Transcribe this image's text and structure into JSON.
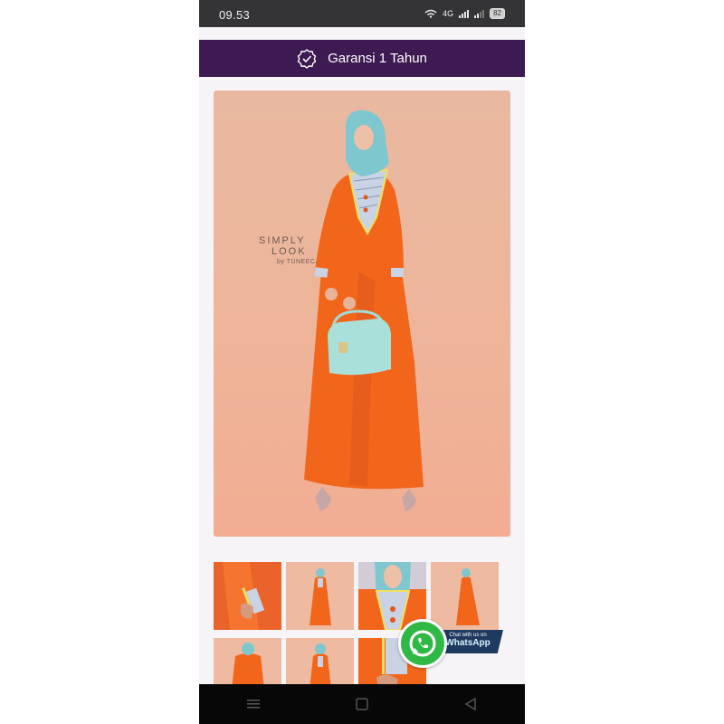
{
  "status_bar": {
    "time": "09.53",
    "network_label": "4G",
    "battery_level": "82"
  },
  "warranty": {
    "label": "Garansi 1 Tahun",
    "icon": "badge-check-icon"
  },
  "product": {
    "main_image_icon": "product-photo",
    "watermark_line1": "SIMPLY",
    "watermark_line2": "LOOK",
    "watermark_line3": "by TUNEECA",
    "thumbnails": [
      {
        "name": "thumbnail-1-sleeve-detail"
      },
      {
        "name": "thumbnail-2-full-front"
      },
      {
        "name": "thumbnail-3-collar-detail"
      },
      {
        "name": "thumbnail-4-full-side"
      },
      {
        "name": "thumbnail-5-back"
      },
      {
        "name": "thumbnail-6-full"
      },
      {
        "name": "thumbnail-7-detail"
      }
    ]
  },
  "whatsapp": {
    "line1": "Chat with us on",
    "line2": "WhatsApp",
    "brand_color": "#2fb844"
  },
  "colors": {
    "header": "#3e1a52",
    "dress": "#f2661c",
    "hijab": "#7fc7cf"
  },
  "nav": {
    "icons": [
      "menu-icon",
      "home-icon",
      "back-icon"
    ]
  }
}
